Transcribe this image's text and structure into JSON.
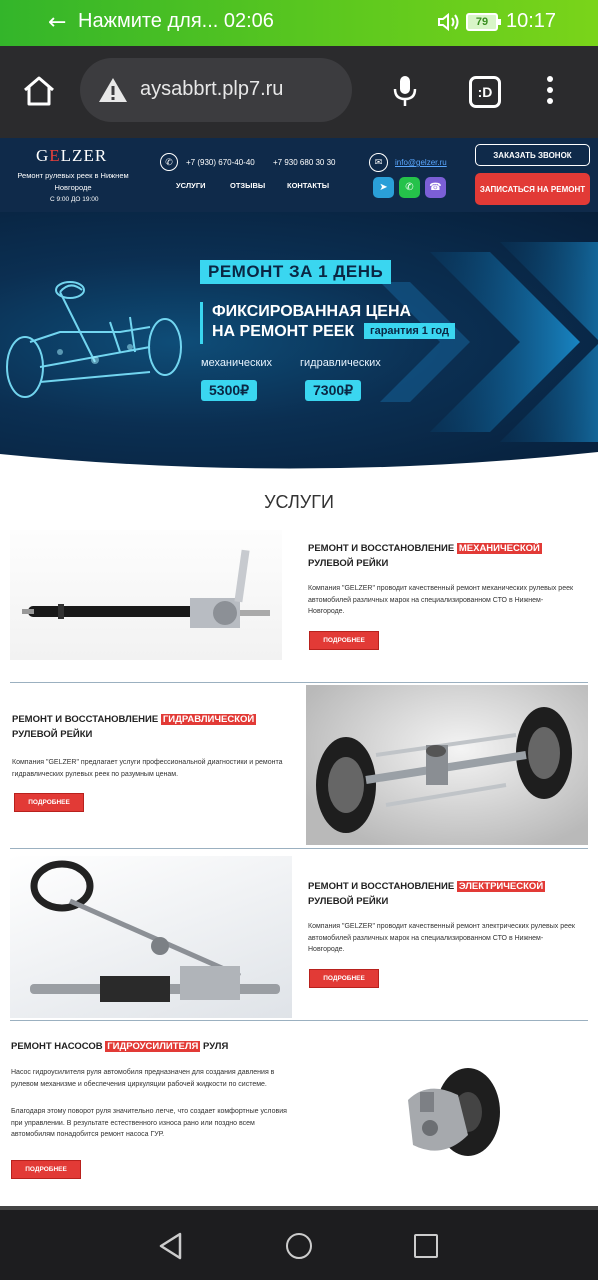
{
  "status_bar": {
    "notification": "Нажмите для... 02:06",
    "battery": "79",
    "time": "10:17"
  },
  "browser": {
    "url": "aysabbrt.plp7.ru",
    "tabs_label": ":D"
  },
  "header": {
    "logo_prefix": "G",
    "logo_accent": "E",
    "logo_suffix": "LZER",
    "tagline": "Ремонт рулевых реек в Нижнем Новгороде",
    "hours": "С 9:00 ДО 19:00",
    "phone1": "+7 (930) 670-40-40",
    "phone2": "+7 930 680 30 30",
    "email": "info@gelzer.ru",
    "nav": [
      "УСЛУГИ",
      "ОТЗЫВЫ",
      "КОНТАКТЫ"
    ],
    "call_button": "ЗАКАЗАТЬ ЗВОНОК",
    "book_button": "ЗАПИСАТЬСЯ НА РЕМОНТ"
  },
  "hero": {
    "badge": "РЕМОНТ ЗА 1 ДЕНЬ",
    "line1": "ФИКСИРОВАННАЯ ЦЕНА",
    "line2": "НА РЕМОНТ РЕЕК",
    "guarantee": "гарантия 1 год",
    "mech_label": "механических",
    "hydro_label": "гидравлических",
    "mech_price": "5300₽",
    "hydro_price": "7300₽"
  },
  "services": {
    "title": "УСЛУГИ",
    "more": "ПОДРОБНЕЕ",
    "items": [
      {
        "pre": "РЕМОНТ И ВОССТАНОВЛЕНИЕ ",
        "highlight": "МЕХАНИЧЕСКОЙ",
        "post": "РУЛЕВОЙ РЕЙКИ",
        "text": "Компания \"GELZER\"  проводит качественный ремонт механических рулевых реек автомобилей различных марок на специализированном СТО в Нижнем-Новгороде."
      },
      {
        "pre": "РЕМОНТ И ВОССТАНОВЛЕНИЕ ",
        "highlight": "ГИДРАВЛИЧЕСКОЙ",
        "post": "РУЛЕВОЙ РЕЙКИ",
        "text": "Компания \"GELZER\" предлагает услуги профессиональной диагностики и ремонта гидравлических рулевых реек по разумным ценам."
      },
      {
        "pre": "РЕМОНТ И ВОССТАНОВЛЕНИЕ ",
        "highlight": "ЭЛЕКТРИЧЕСКОЙ",
        "post": "РУЛЕВОЙ РЕЙКИ",
        "text": "Компания \"GELZER\"  проводит качественный ремонт электрических рулевых реек автомобилей различных марок на специализированном СТО в Нижнем-Новгороде."
      },
      {
        "pre": "РЕМОНТ НАСОСОВ ",
        "highlight": "ГИДРОУСИЛИТЕЛЯ",
        "post": " РУЛЯ",
        "text": "Насос гидроусилителя руля автомобиля предназначен для создания давления в рулевом механизме и обеспечения циркуляции рабочей жидкости по системе.",
        "text2": "Благодаря этому поворот руля значительно легче, что создает комфортные условия при управлении. В результате естественного износа рано или поздно всем автомобилям понадобится ремонт насоса ГУР."
      }
    ]
  },
  "colors": {
    "accent_red": "#e23a36",
    "accent_cyan": "#3ad6f0",
    "navy": "#0f2a4a",
    "status_green": "#4cbf24"
  },
  "icons": [
    "back-arrow-icon",
    "volume-icon",
    "battery-icon",
    "home-icon",
    "warning-icon",
    "mic-icon",
    "tabs-icon",
    "menu-icon",
    "phone-icon",
    "mail-icon",
    "telegram-icon",
    "whatsapp-icon",
    "viber-icon",
    "nav-back-icon",
    "nav-home-icon",
    "nav-recent-icon"
  ]
}
